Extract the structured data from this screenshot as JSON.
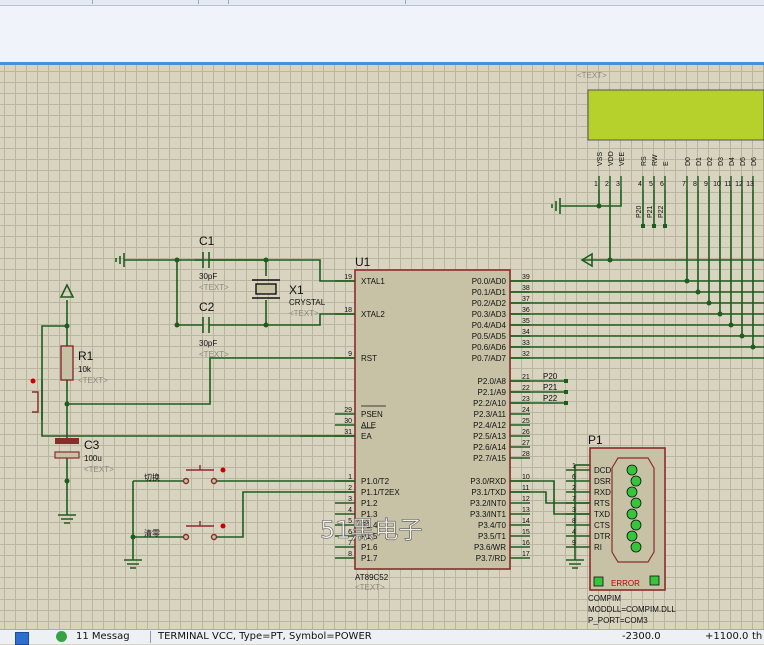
{
  "schematic": {
    "text_placeholder": "<TEXT>",
    "u1": {
      "ref": "U1",
      "part": "AT89C52",
      "left_pins": [
        {
          "num": "19",
          "name": "XTAL1"
        },
        {
          "num": "18",
          "name": "XTAL2"
        },
        {
          "num": "9",
          "name": "RST"
        },
        {
          "num": "29",
          "name": "PSEN"
        },
        {
          "num": "30",
          "name": "ALE"
        },
        {
          "num": "31",
          "name": "EA"
        },
        {
          "num": "1",
          "name": "P1.0/T2"
        },
        {
          "num": "2",
          "name": "P1.1/T2EX"
        },
        {
          "num": "3",
          "name": "P1.2"
        },
        {
          "num": "4",
          "name": "P1.3"
        },
        {
          "num": "5",
          "name": "P1.4"
        },
        {
          "num": "6",
          "name": "P1.5"
        },
        {
          "num": "7",
          "name": "P1.6"
        },
        {
          "num": "8",
          "name": "P1.7"
        }
      ],
      "right_pins": [
        {
          "num": "39",
          "name": "P0.0/AD0"
        },
        {
          "num": "38",
          "name": "P0.1/AD1"
        },
        {
          "num": "37",
          "name": "P0.2/AD2"
        },
        {
          "num": "36",
          "name": "P0.3/AD3"
        },
        {
          "num": "35",
          "name": "P0.4/AD4"
        },
        {
          "num": "34",
          "name": "P0.5/AD5"
        },
        {
          "num": "33",
          "name": "P0.6/AD6"
        },
        {
          "num": "32",
          "name": "P0.7/AD7"
        },
        {
          "num": "21",
          "name": "P2.0/A8"
        },
        {
          "num": "22",
          "name": "P2.1/A9"
        },
        {
          "num": "23",
          "name": "P2.2/A10"
        },
        {
          "num": "24",
          "name": "P2.3/A11"
        },
        {
          "num": "25",
          "name": "P2.4/A12"
        },
        {
          "num": "26",
          "name": "P2.5/A13"
        },
        {
          "num": "27",
          "name": "P2.6/A14"
        },
        {
          "num": "28",
          "name": "P2.7/A15"
        },
        {
          "num": "10",
          "name": "P3.0/RXD"
        },
        {
          "num": "11",
          "name": "P3.1/TXD"
        },
        {
          "num": "12",
          "name": "P3.2/INT0"
        },
        {
          "num": "13",
          "name": "P3.3/INT1"
        },
        {
          "num": "14",
          "name": "P3.4/T0"
        },
        {
          "num": "15",
          "name": "P3.5/T1"
        },
        {
          "num": "16",
          "name": "P3.6/WR"
        },
        {
          "num": "17",
          "name": "P3.7/RD"
        }
      ]
    },
    "c1": {
      "ref": "C1",
      "value": "30pF"
    },
    "c2": {
      "ref": "C2",
      "value": "30pF"
    },
    "c3": {
      "ref": "C3",
      "value": "100u"
    },
    "r1": {
      "ref": "R1",
      "value": "10k"
    },
    "x1": {
      "ref": "X1",
      "value": "CRYSTAL"
    },
    "switch1_label": "切换",
    "switch2_label": "清零",
    "net_labels": [
      "P20",
      "P21",
      "P22"
    ],
    "lcd": {
      "pin_names": [
        "VSS",
        "VDD",
        "VEE",
        "RS",
        "RW",
        "E",
        "D0",
        "D1",
        "D2",
        "D3",
        "D4",
        "D5",
        "D6"
      ],
      "pin_nums": [
        "1",
        "2",
        "3",
        "4",
        "5",
        "6",
        "7",
        "8",
        "9",
        "10",
        "11",
        "12",
        "13"
      ],
      "net_labels": [
        "P20",
        "P21",
        "P22"
      ]
    },
    "p1": {
      "ref": "P1",
      "pins": [
        {
          "num": "1",
          "name": "DCD"
        },
        {
          "num": "6",
          "name": "DSR"
        },
        {
          "num": "2",
          "name": "RXD"
        },
        {
          "num": "7",
          "name": "RTS"
        },
        {
          "num": "3",
          "name": "TXD"
        },
        {
          "num": "8",
          "name": "CTS"
        },
        {
          "num": "4",
          "name": "DTR"
        },
        {
          "num": "9",
          "name": "RI"
        }
      ],
      "error": "ERROR",
      "props": [
        "COMPIM",
        "MODDLL=COMPIM.DLL",
        "P_PORT=COM3"
      ]
    },
    "watermark": "51黑电子"
  },
  "status": {
    "messages": "11 Messag",
    "props": "TERMINAL VCC, Type=PT, Symbol=POWER",
    "x_coord": "-2300.0",
    "y_coord": "+1100.0",
    "unit": "th"
  },
  "colors": {
    "wire": "#1f5c1f",
    "body_outline": "#8b2b2b",
    "body_fill": "#c7c2a6",
    "lcd_screen": "#b6d12b",
    "grid_bg": "#d8d4c0",
    "port_green": "#35c43a"
  }
}
